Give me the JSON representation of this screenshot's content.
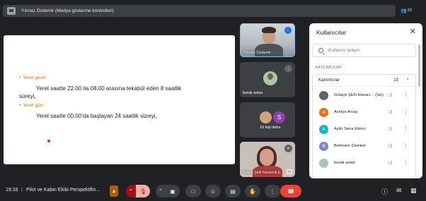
{
  "topbar": {
    "presenter_label": "Yılmaz Özdemir (Medya gösterme kontrolleri)",
    "participants_badge": "23",
    "pin_icon": "presentation-icon"
  },
  "slide": {
    "bullet1_label": "Yerel gece:",
    "bullet1_text_line1": "Yerel saatte 22.00 ila 08.00 arasına tekabül eden 8 saatlik",
    "bullet1_text_line2": "süreyi,",
    "bullet2_label": "Yerel gün:",
    "bullet2_text": "Yerel saatte 00.00'da başlayan 24 saatlik süreyi,"
  },
  "tiles": [
    {
      "name": "Yılmaz Özdemir"
    },
    {
      "name": "burak aslan"
    },
    {
      "name": "19 kişi daha",
      "avatar_letter": "S"
    },
    {
      "name": "Gülaçtı ŞEN Havacılık E..."
    }
  ],
  "panel": {
    "title": "Kullanıcılar",
    "search_placeholder": "Kullanıcı arayın",
    "section_label": "KATILIMCILAR",
    "group_label": "Katılımcılar",
    "group_count": "23",
    "participants": [
      {
        "name": "Gülaçtı ŞEN Havacı... (Siz)",
        "letter": "",
        "color": "#5f6368"
      },
      {
        "name": "Acelya Arcay",
        "letter": "A",
        "color": "#e8710a"
      },
      {
        "name": "Aylin Sena Ekinci",
        "letter": "A",
        "color": "#12b5cb"
      },
      {
        "name": "Berkcem Demirer",
        "letter": "B",
        "color": "#7986cb"
      },
      {
        "name": "burak aslan",
        "letter": "",
        "color": "#a8c7b0"
      }
    ]
  },
  "bottom": {
    "time": "19:33",
    "separator": "|",
    "meeting_title": "Pilot ve Kabin Ekibi Perspektifin..."
  },
  "colors": {
    "accent": "#1a73e8",
    "end_call": "#ea4335",
    "slide_bullet": "#e8710a"
  }
}
